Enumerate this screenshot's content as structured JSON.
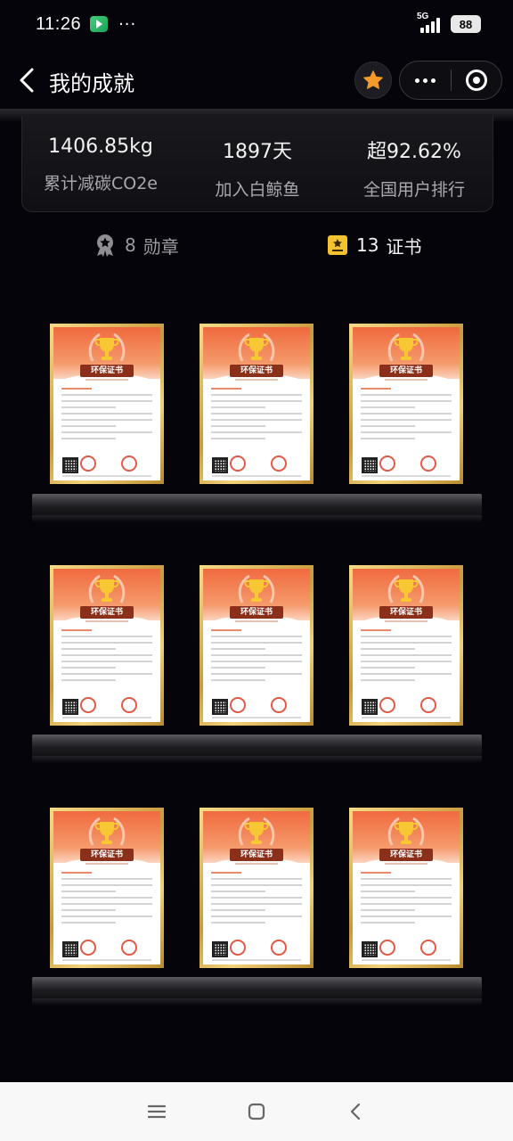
{
  "status_bar": {
    "time": "11:26",
    "more": "···",
    "network": "5G",
    "battery": "88"
  },
  "nav": {
    "title": "我的成就",
    "icons": [
      "back-arrow-icon",
      "star-icon",
      "more-icon",
      "close-mini-program-icon"
    ],
    "accent_color": "#f39a2a"
  },
  "stats": [
    {
      "value": "1406.85kg",
      "label": "累计减碳CO2e"
    },
    {
      "value": "1897天",
      "label": "加入白鲸鱼"
    },
    {
      "value": "超92.62%",
      "label": "全国用户排行"
    }
  ],
  "tabs": [
    {
      "count": "8",
      "label": "勋章",
      "icon": "medal-icon",
      "selected": false
    },
    {
      "count": "13",
      "label": "证书",
      "icon": "certificate-icon",
      "selected": true
    }
  ],
  "certificates": [
    {
      "title": "环保证书"
    },
    {
      "title": "环保证书"
    },
    {
      "title": "环保证书"
    },
    {
      "title": "环保证书"
    },
    {
      "title": "环保证书"
    },
    {
      "title": "环保证书"
    },
    {
      "title": "环保证书"
    },
    {
      "title": "环保证书"
    },
    {
      "title": "环保证书"
    }
  ],
  "system_nav": [
    "menu-icon",
    "home-square-icon",
    "back-chevron-icon"
  ]
}
